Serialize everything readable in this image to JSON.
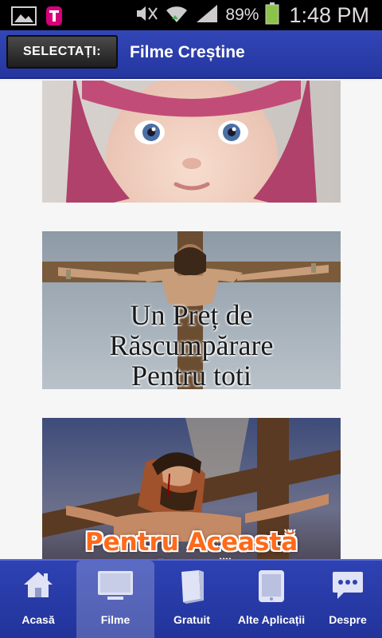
{
  "status_bar": {
    "battery_percent": "89%",
    "time": "1:48 PM",
    "icons": [
      "gallery-icon",
      "tmobile-icon",
      "mute-icon",
      "wifi-icon",
      "signal-icon",
      "battery-icon"
    ]
  },
  "header": {
    "select_label": "SELECTAȚI:",
    "title": "Filme Creștine",
    "accent_color": "#2b3fae"
  },
  "content": {
    "cards": [
      {
        "caption": ""
      },
      {
        "caption_lines": [
          "Un Preț de",
          "Răscumpărare",
          "Pentru toti"
        ]
      },
      {
        "caption": "Pentru Această Cauză"
      }
    ]
  },
  "bottom_nav": {
    "items": [
      {
        "label": "Acasă",
        "icon": "home-icon"
      },
      {
        "label": "Filme",
        "icon": "monitor-icon",
        "active": true
      },
      {
        "label": "Gratuit",
        "icon": "book-icon"
      },
      {
        "label": "Alte Aplicații",
        "icon": "tablet-icon"
      },
      {
        "label": "Despre",
        "icon": "chat-bubble-icon"
      }
    ]
  }
}
